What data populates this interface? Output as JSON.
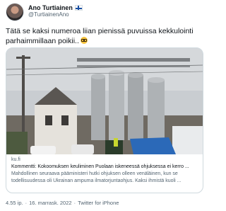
{
  "tweet": {
    "author": {
      "display_name": "Ano Turtiainen",
      "handle": "@TurtiainenAno",
      "flag_icon": "finland-flag-icon"
    },
    "text": "Tätä se kaksi numeroa liian pienissä puvuissa kekkulointi parhaimmillaan poikii..",
    "emoji": "nerd-face-glasses-icon",
    "link_card": {
      "domain": "ku.fi",
      "title": "Kommentti: Kokoomuksen keuliminen Puolaan iskeneessä ohjuksessa ei kerro ...",
      "description": "Mahdollinen seuraava pääministeri hutki ohjuksen olleen venäläinen, kun se todellisuudessa oli Ukrainan ampuma ilmatorjuntaohjus. Kaksi ihmistä kuoli ..."
    },
    "meta": {
      "time": "4.55 ip.",
      "separator": "·",
      "date": "16. marrask. 2022",
      "source": "Twitter for iPhone"
    }
  },
  "colors": {
    "text_primary": "#0f1419",
    "text_secondary": "#536471",
    "card_border": "#cfd9de"
  }
}
